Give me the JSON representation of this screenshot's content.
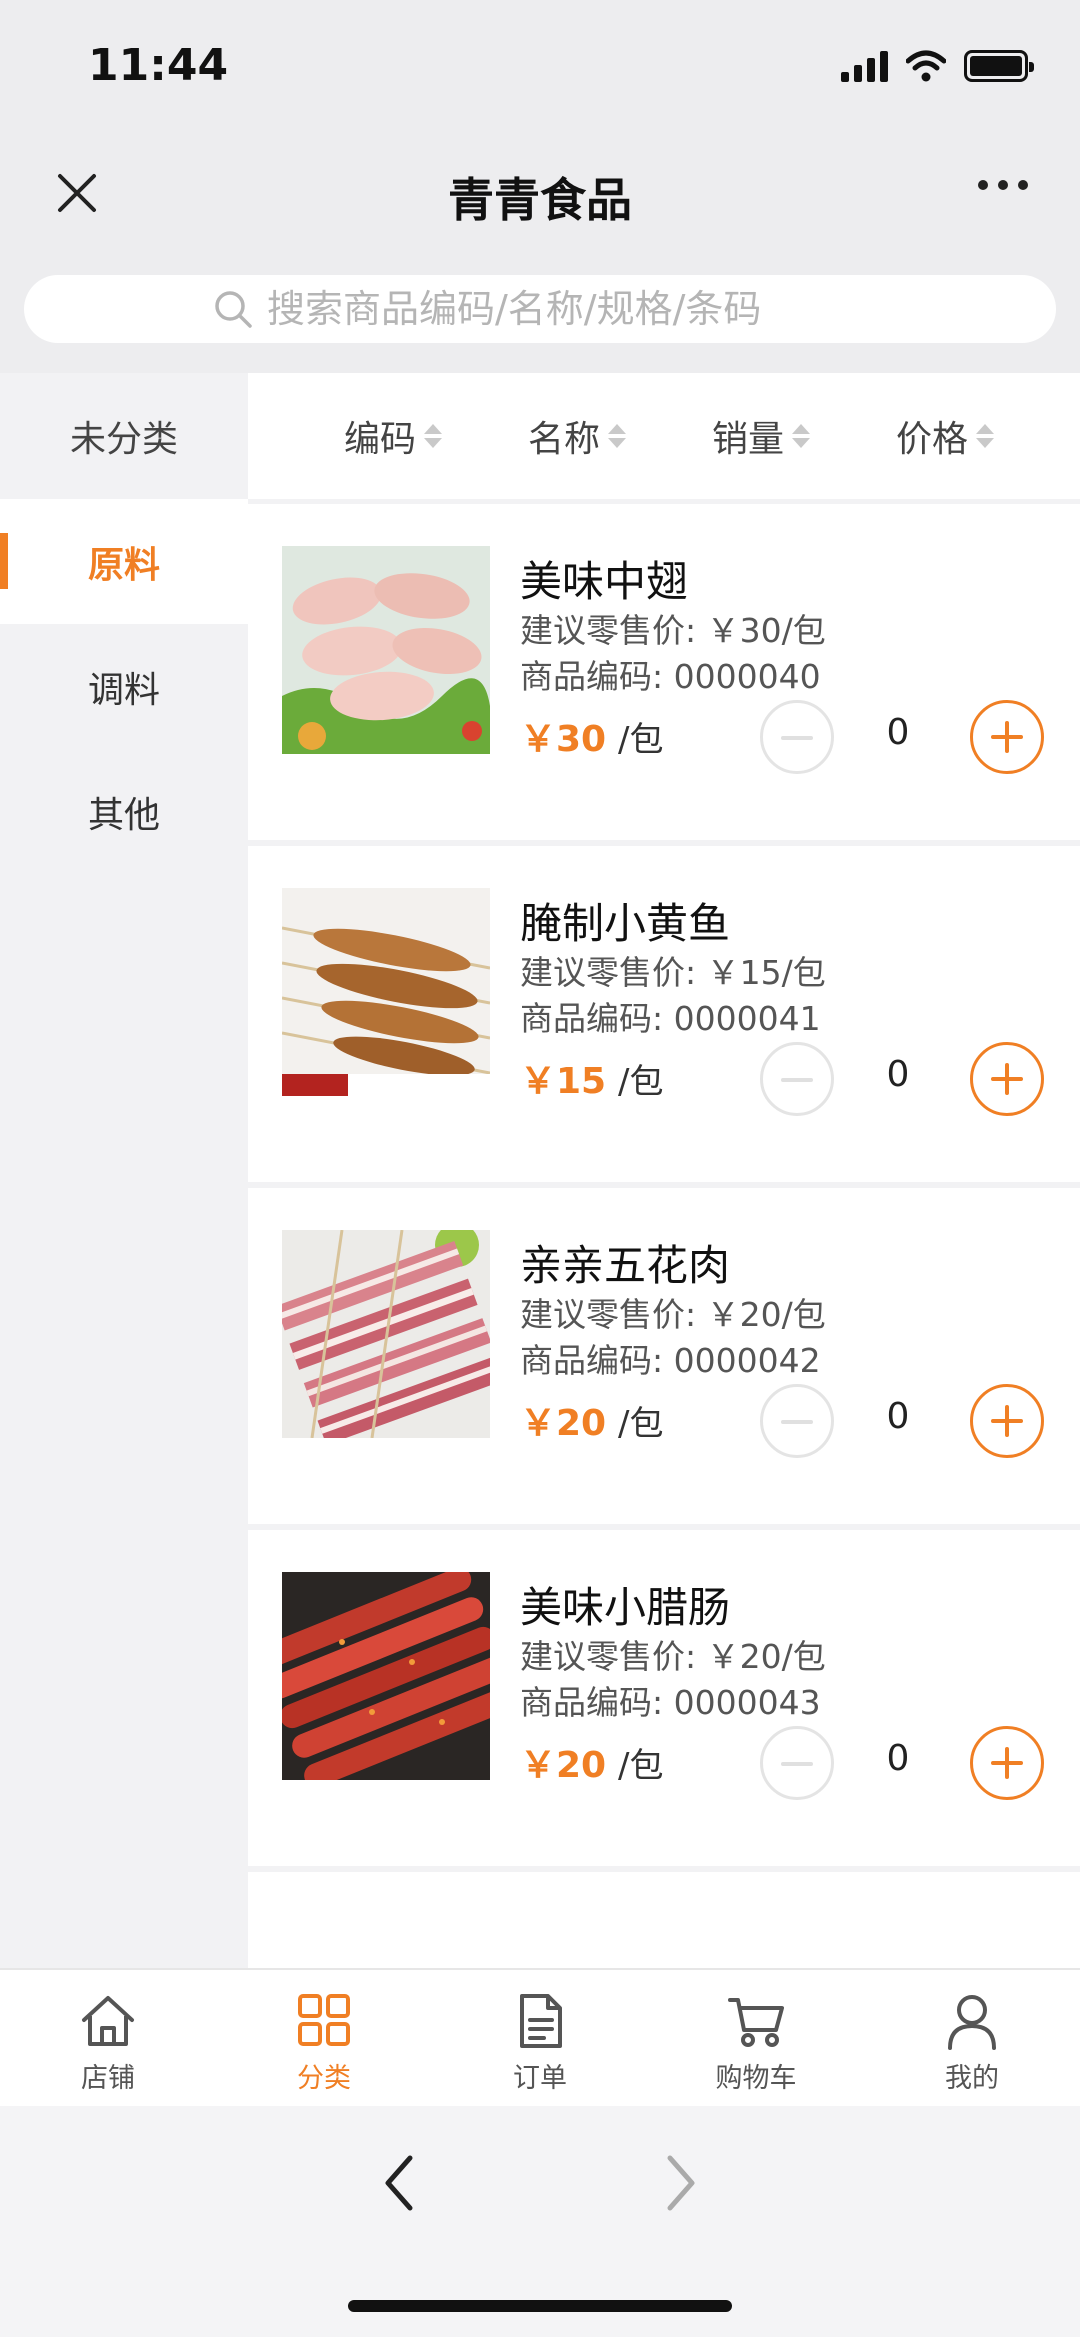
{
  "status": {
    "time": "11:44"
  },
  "header": {
    "title": "青青食品"
  },
  "search": {
    "placeholder": "搜索商品编码/名称/规格/条码"
  },
  "sidebar": {
    "header": "未分类",
    "items": [
      {
        "label": "原料",
        "active": true
      },
      {
        "label": "调料",
        "active": false
      },
      {
        "label": "其他",
        "active": false
      }
    ]
  },
  "sort": {
    "code": "编码",
    "name": "名称",
    "sales": "销量",
    "price": "价格"
  },
  "products": [
    {
      "name": "美味中翅",
      "msrp": "建议零售价: ￥30/包",
      "code": "商品编码: 0000040",
      "price": "￥30",
      "unit": "/包",
      "qty": "0"
    },
    {
      "name": "腌制小黄鱼",
      "msrp": "建议零售价: ￥15/包",
      "code": "商品编码: 0000041",
      "price": "￥15",
      "unit": "/包",
      "qty": "0"
    },
    {
      "name": "亲亲五花肉",
      "msrp": "建议零售价: ￥20/包",
      "code": "商品编码: 0000042",
      "price": "￥20",
      "unit": "/包",
      "qty": "0"
    },
    {
      "name": "美味小腊肠",
      "msrp": "建议零售价: ￥20/包",
      "code": "商品编码: 0000043",
      "price": "￥20",
      "unit": "/包",
      "qty": "0"
    }
  ],
  "tabs": [
    {
      "label": "店铺",
      "icon": "store-icon"
    },
    {
      "label": "分类",
      "icon": "category-icon",
      "active": true
    },
    {
      "label": "订单",
      "icon": "order-icon"
    },
    {
      "label": "购物车",
      "icon": "cart-icon"
    },
    {
      "label": "我的",
      "icon": "profile-icon"
    }
  ],
  "colors": {
    "accent": "#f07f24",
    "text": "#222222",
    "muted": "#b5b5b5"
  }
}
